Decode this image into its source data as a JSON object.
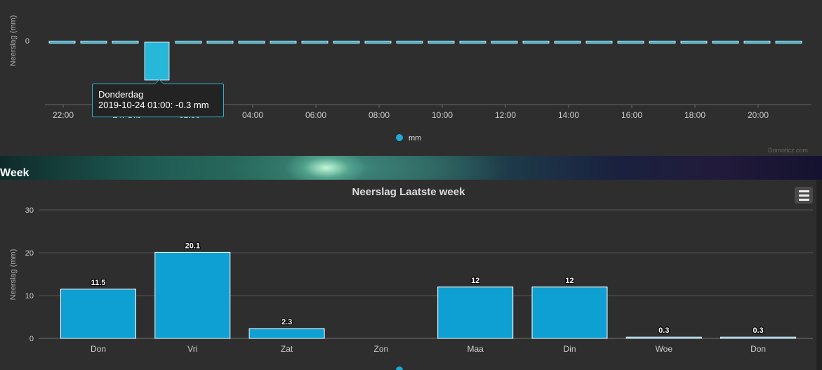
{
  "chart_data": [
    {
      "type": "bar",
      "ylabel": "Neerslag (mm)",
      "yticks": [
        0
      ],
      "x_tick_labels": [
        "22:00",
        "24. Okt",
        "02:00",
        "04:00",
        "06:00",
        "08:00",
        "10:00",
        "12:00",
        "14:00",
        "16:00",
        "18:00",
        "20:00"
      ],
      "values": [
        0,
        0,
        0,
        -0.3,
        0,
        0,
        0,
        0,
        0,
        0,
        0,
        0,
        0,
        0,
        0,
        0,
        0,
        0,
        0,
        0,
        0,
        0,
        0,
        0
      ],
      "legend": [
        {
          "name": "mm",
          "color": "#1ea9d6"
        }
      ],
      "legend_position": "bottom-center",
      "tooltip": {
        "title": "Donderdag",
        "body": "2019-10-24 01:00: -0.3 mm"
      },
      "bar_color": "#27b7d8",
      "credits": "Domoticz.com"
    },
    {
      "type": "bar",
      "title": "Neerslag Laatste week",
      "ylabel": "Neerslag (mm)",
      "ylim": [
        0,
        30
      ],
      "yticks": [
        0,
        10,
        20,
        30
      ],
      "categories": [
        "Don",
        "Vri",
        "Zat",
        "Zon",
        "Maa",
        "Din",
        "Woe",
        "Don"
      ],
      "values": [
        11.5,
        20.1,
        2.3,
        0,
        12,
        12,
        0.3,
        0.3
      ],
      "data_labels": [
        "11.5",
        "20.1",
        "2.3",
        "",
        "12",
        "12",
        "0.3",
        "0.3"
      ],
      "bar_color": "#0fa0d3",
      "grid": true
    }
  ],
  "banner": {
    "title": "Week"
  },
  "menu": {
    "icon": "hamburger-icon"
  }
}
